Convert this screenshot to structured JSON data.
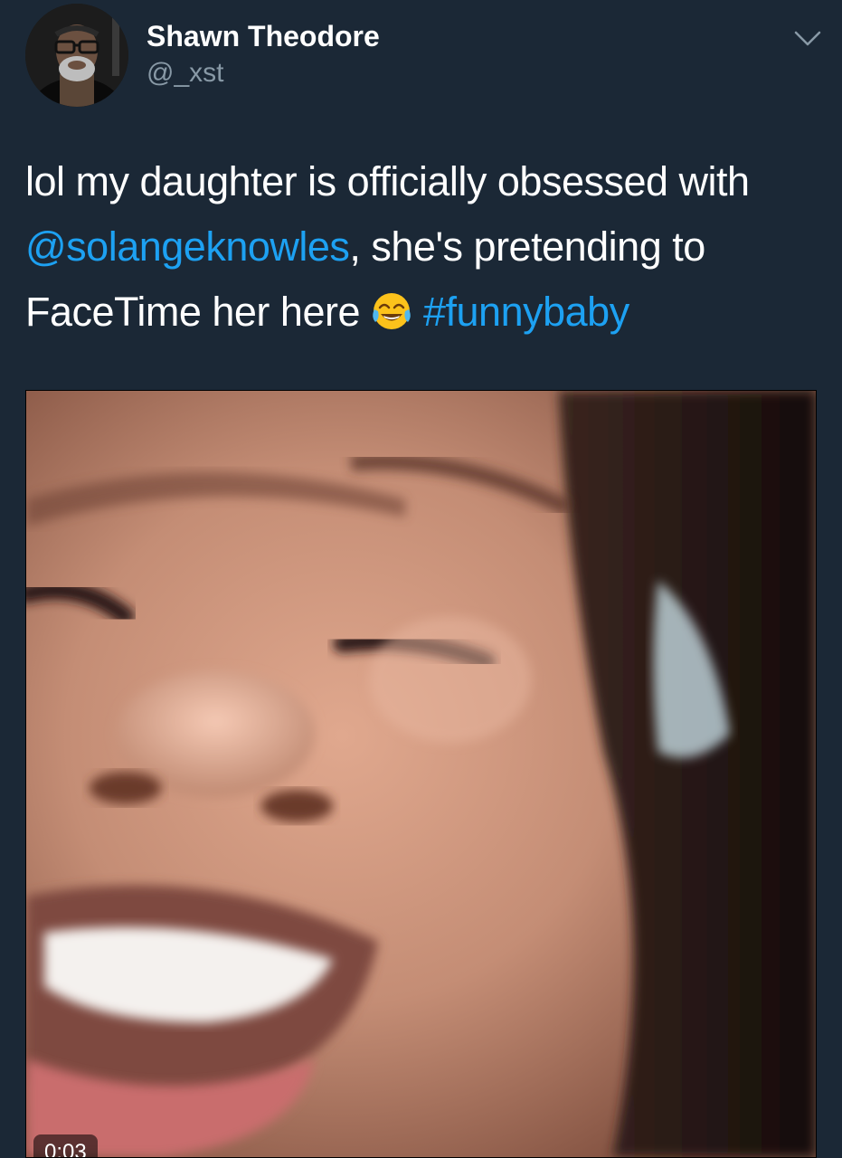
{
  "tweet": {
    "author": {
      "display_name": "Shawn Theodore",
      "handle": "@_xst"
    },
    "text": {
      "part1": "lol my daughter is officially obsessed with ",
      "mention": "@solangeknowles",
      "part2": ", she's pretending to FaceTime her here ",
      "emoji": "face-with-tears-of-joy",
      "hashtag": "#funnybaby"
    },
    "media": {
      "type": "video",
      "duration": "0:03"
    }
  },
  "colors": {
    "background": "#1b2836",
    "text": "#ffffff",
    "secondary_text": "#8899a6",
    "link": "#1da1f2"
  }
}
